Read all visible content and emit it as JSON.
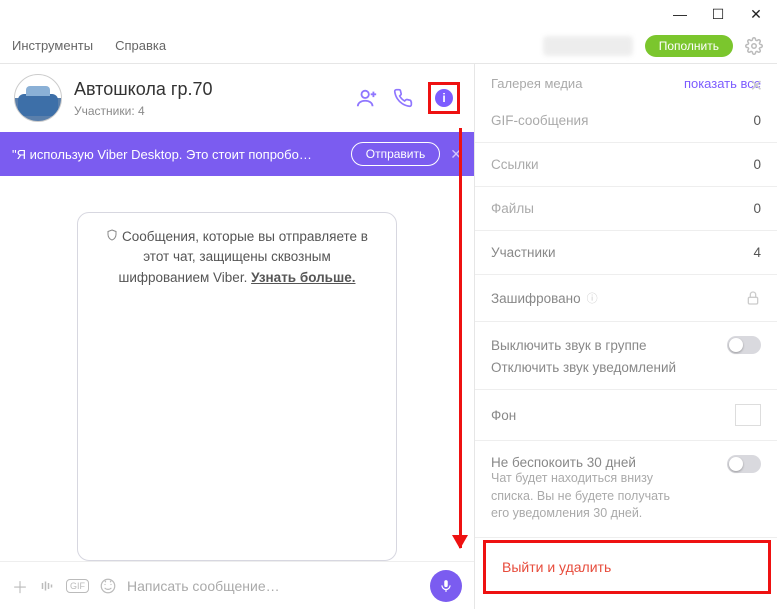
{
  "window": {
    "min": "—",
    "max": "☐",
    "close": "✕"
  },
  "menu": {
    "tools": "Инструменты",
    "help": "Справка"
  },
  "topup": "Пополнить",
  "chat": {
    "title": "Автошкола гр.70",
    "participants_label": "Участники: 4"
  },
  "promo": {
    "text": "\"Я использую Viber Desktop. Это стоит попробо…",
    "send": "Отправить"
  },
  "e2e": {
    "line": "Сообщения, которые вы отправляете в этот чат, защищены сквозным шифрованием Viber.",
    "learn_more": "Узнать больше."
  },
  "composer": {
    "placeholder": "Написать сообщение…"
  },
  "panel": {
    "media_gallery": "Галерея медиа",
    "show_all": "показать все",
    "gif_label": "GIF-сообщения",
    "gif_count": "0",
    "links_label": "Ссылки",
    "links_count": "0",
    "files_label": "Файлы",
    "files_count": "0",
    "participants_label": "Участники",
    "participants_count": "4",
    "encrypted_label": "Зашифровано",
    "mute_group": "Выключить звук в группе",
    "mute_notifications": "Отключить звук уведомлений",
    "background": "Фон",
    "dnd_title": "Не беспокоить 30 дней",
    "dnd_desc": "Чат будет находиться внизу списка. Вы не будете получать его уведомления 30 дней.",
    "leave": "Выйти и удалить"
  }
}
